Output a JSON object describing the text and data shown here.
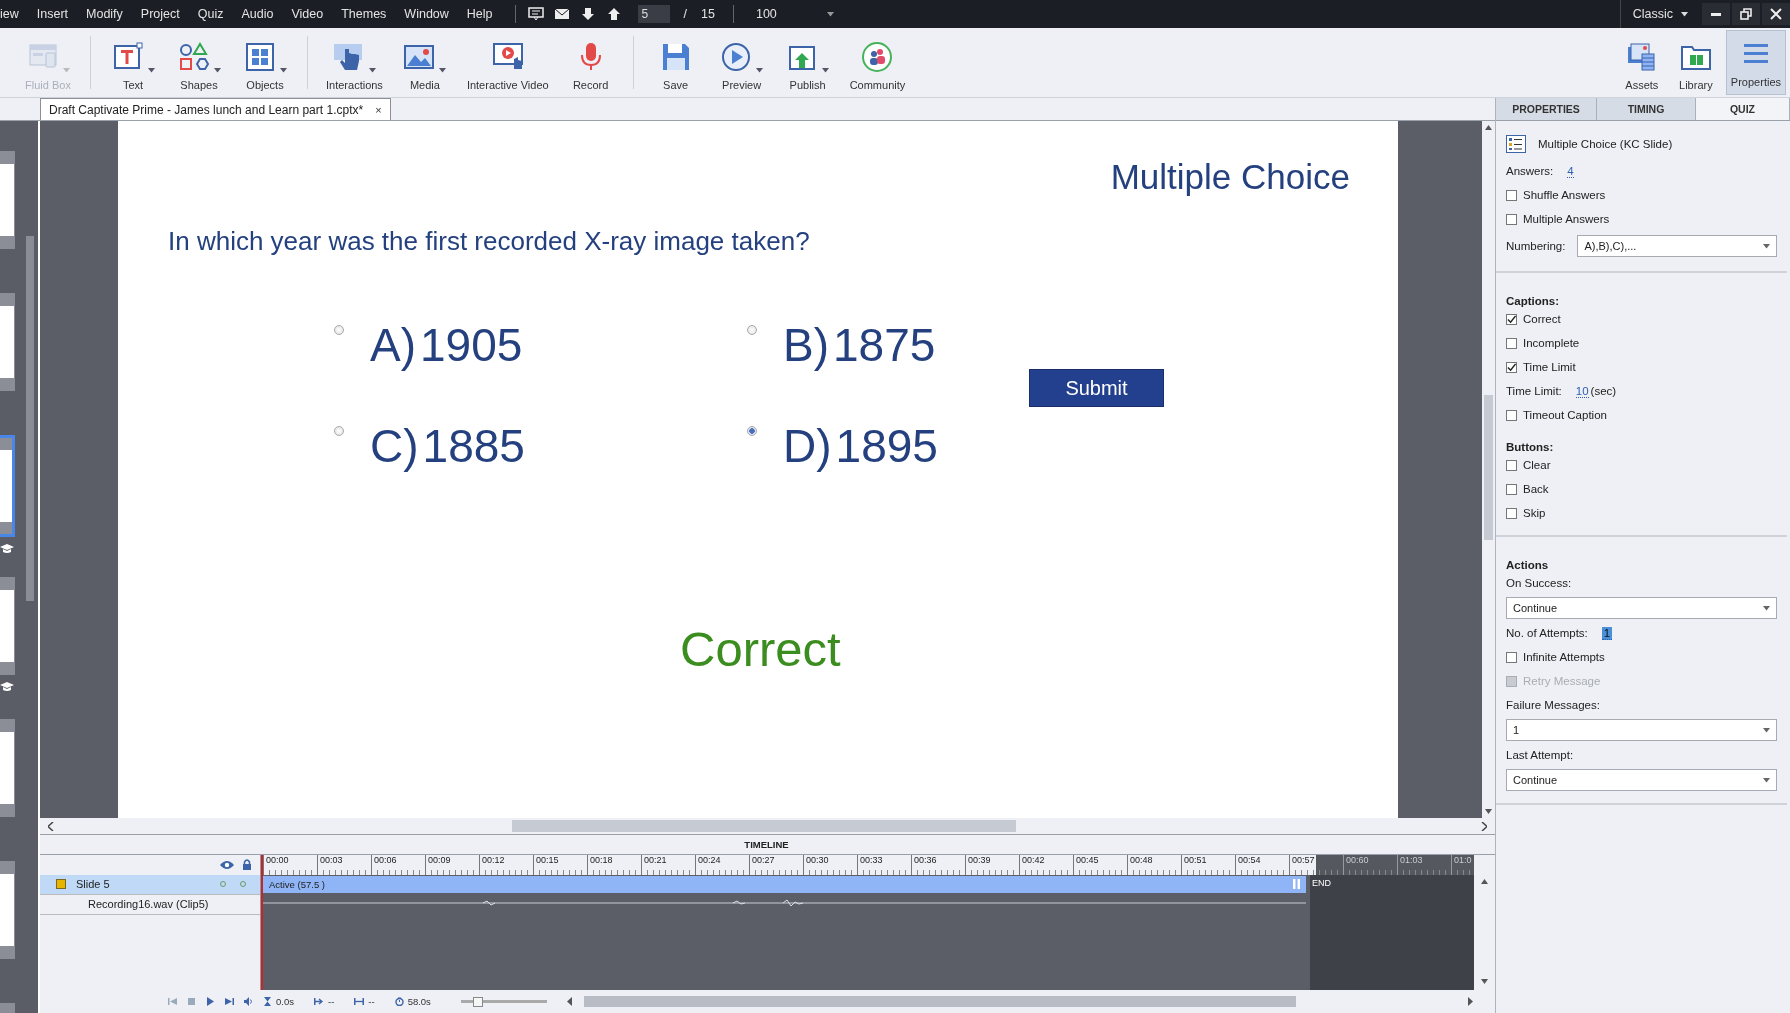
{
  "menu_bar": {
    "items": [
      "iew",
      "Insert",
      "Modify",
      "Project",
      "Quiz",
      "Audio",
      "Video",
      "Themes",
      "Window",
      "Help"
    ],
    "slide_number": "5",
    "slide_separator": "/",
    "slide_total": "15",
    "zoom": "100",
    "workspace": "Classic"
  },
  "toolbar": {
    "groups": [
      [
        {
          "label": "Fluid Box",
          "disabled": true,
          "dropdown": true
        }
      ],
      [
        {
          "label": "Text",
          "disabled": false,
          "dropdown": true
        },
        {
          "label": "Shapes",
          "disabled": false,
          "dropdown": true
        },
        {
          "label": "Objects",
          "disabled": false,
          "dropdown": true
        }
      ],
      [
        {
          "label": "Interactions",
          "disabled": false,
          "dropdown": true
        },
        {
          "label": "Media",
          "disabled": false,
          "dropdown": true
        },
        {
          "label": "Interactive Video",
          "disabled": false,
          "dropdown": false
        },
        {
          "label": "Record",
          "disabled": false,
          "dropdown": false
        }
      ],
      [
        {
          "label": "Save",
          "disabled": false,
          "dropdown": false
        },
        {
          "label": "Preview",
          "disabled": false,
          "dropdown": true
        },
        {
          "label": "Publish",
          "disabled": false,
          "dropdown": true
        },
        {
          "label": "Community",
          "disabled": false,
          "dropdown": false
        }
      ]
    ],
    "panels": [
      {
        "label": "Assets",
        "selected": false
      },
      {
        "label": "Library",
        "selected": false
      },
      {
        "label": "Properties",
        "selected": true
      }
    ]
  },
  "document_tab": {
    "title": "Draft Captivate Prime - James lunch and Learn part 1.cptx*",
    "close": "×"
  },
  "filmstrip": {
    "slides": [
      {
        "selected": false,
        "quiz": false
      },
      {
        "selected": false,
        "quiz": false
      },
      {
        "selected": true,
        "quiz": true
      },
      {
        "selected": false,
        "quiz": true
      },
      {
        "selected": false,
        "quiz": false
      },
      {
        "selected": false,
        "quiz": false
      },
      {
        "selected": false
      }
    ]
  },
  "slide": {
    "title": "Multiple Choice",
    "question": "In which year was the first recorded X-ray image taken?",
    "answers": [
      {
        "label": "A)",
        "text": "1905",
        "selected": false
      },
      {
        "label": "B)",
        "text": "1875",
        "selected": false
      },
      {
        "label": "C)",
        "text": "1885",
        "selected": false
      },
      {
        "label": "D)",
        "text": "1895",
        "selected": true
      }
    ],
    "submit": "Submit",
    "feedback": "Correct"
  },
  "panel": {
    "tabs": [
      {
        "label": "PROPERTIES",
        "selected": false
      },
      {
        "label": "TIMING",
        "selected": false
      },
      {
        "label": "QUIZ",
        "selected": true
      }
    ],
    "sections": [
      {
        "items": [
          {
            "kind": "title",
            "text": "Multiple Choice (KC Slide)"
          },
          {
            "kind": "value",
            "label": "Answers:",
            "value": "4",
            "highlighted": false
          },
          {
            "kind": "checkbox",
            "label": "Shuffle Answers",
            "checked": false,
            "disabled": false
          },
          {
            "kind": "checkbox",
            "label": "Multiple Answers",
            "checked": false,
            "disabled": false
          },
          {
            "kind": "inline_select",
            "label": "Numbering:",
            "value": "A),B),C),..."
          }
        ]
      },
      {
        "items": [
          {
            "kind": "heading",
            "text": "Captions:"
          },
          {
            "kind": "checkbox",
            "label": "Correct",
            "checked": true,
            "disabled": false
          },
          {
            "kind": "checkbox",
            "label": "Incomplete",
            "checked": false,
            "disabled": false
          },
          {
            "kind": "checkbox",
            "label": "Time Limit",
            "checked": true,
            "disabled": false
          },
          {
            "kind": "value",
            "label": "Time Limit:",
            "value": "10",
            "suffix": "(sec)",
            "highlighted": false
          },
          {
            "kind": "checkbox",
            "label": "Timeout Caption",
            "checked": false,
            "disabled": false
          },
          {
            "kind": "heading",
            "text": "Buttons:"
          },
          {
            "kind": "checkbox",
            "label": "Clear",
            "checked": false,
            "disabled": false
          },
          {
            "kind": "checkbox",
            "label": "Back",
            "checked": false,
            "disabled": false
          },
          {
            "kind": "checkbox",
            "label": "Skip",
            "checked": false,
            "disabled": false
          }
        ]
      },
      {
        "items": [
          {
            "kind": "heading",
            "text": "Actions"
          },
          {
            "kind": "label",
            "text": "On Success:"
          },
          {
            "kind": "select",
            "value": "Continue"
          },
          {
            "kind": "value",
            "label": "No. of Attempts:",
            "value": "1",
            "highlighted": true
          },
          {
            "kind": "checkbox",
            "label": "Infinite Attempts",
            "checked": false,
            "disabled": false
          },
          {
            "kind": "checkbox",
            "label": "Retry Message",
            "checked": false,
            "disabled": true
          },
          {
            "kind": "label",
            "text": "Failure Messages:"
          },
          {
            "kind": "select",
            "value": "1"
          },
          {
            "kind": "label",
            "text": "Last Attempt:"
          },
          {
            "kind": "select",
            "value": "Continue"
          }
        ]
      }
    ]
  },
  "timeline": {
    "title": "TIMELINE",
    "ticks": [
      "00:00",
      "00:03",
      "00:06",
      "00:09",
      "00:12",
      "00:15",
      "00:18",
      "00:21",
      "00:24",
      "00:27",
      "00:30",
      "00:33",
      "00:36",
      "00:39",
      "00:42",
      "00:45",
      "00:48",
      "00:51",
      "00:54",
      "00:57",
      "00:60",
      "01:03",
      "01:0"
    ],
    "tracks": [
      {
        "kind": "slide",
        "name": "Slide 5",
        "selected": true,
        "bar_label": "Active (57.5 )"
      },
      {
        "kind": "audio",
        "name": "Recording16.wav (Clip5)",
        "selected": false
      }
    ],
    "end_label": "END",
    "current_time": "0.0s",
    "start_time": "--",
    "duration": "--",
    "total_time": "58.0s",
    "zoom": {
      "level": 0.2
    }
  }
}
